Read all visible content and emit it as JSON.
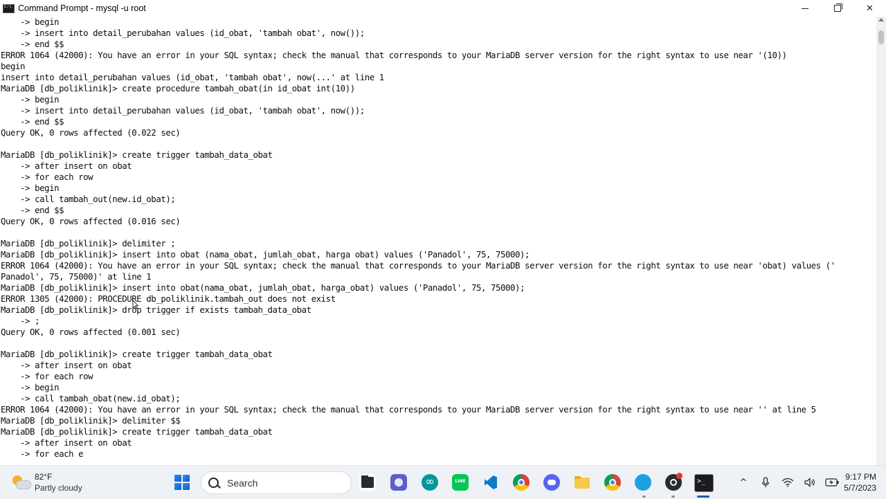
{
  "window": {
    "title": "Command Prompt - mysql  -u root",
    "minimize_icon": "minimize-icon",
    "maximize_icon": "restore-icon",
    "close_glyph": "✕"
  },
  "console_lines": [
    "    -> begin",
    "    -> insert into detail_perubahan values (id_obat, 'tambah obat', now());",
    "    -> end $$",
    "ERROR 1064 (42000): You have an error in your SQL syntax; check the manual that corresponds to your MariaDB server version for the right syntax to use near '(10))",
    "begin",
    "insert into detail_perubahan values (id_obat, 'tambah obat', now(...' at line 1",
    "MariaDB [db_poliklinik]> create procedure tambah_obat(in id_obat int(10))",
    "    -> begin",
    "    -> insert into detail_perubahan values (id_obat, 'tambah obat', now());",
    "    -> end $$",
    "Query OK, 0 rows affected (0.022 sec)",
    "",
    "MariaDB [db_poliklinik]> create trigger tambah_data_obat",
    "    -> after insert on obat",
    "    -> for each row",
    "    -> begin",
    "    -> call tambah_out(new.id_obat);",
    "    -> end $$",
    "Query OK, 0 rows affected (0.016 sec)",
    "",
    "MariaDB [db_poliklinik]> delimiter ;",
    "MariaDB [db_poliklinik]> insert into obat (nama_obat, jumlah_obat, harga obat) values ('Panadol', 75, 75000);",
    "ERROR 1064 (42000): You have an error in your SQL syntax; check the manual that corresponds to your MariaDB server version for the right syntax to use near 'obat) values ('",
    "Panadol', 75, 75000)' at line 1",
    "MariaDB [db_poliklinik]> insert into obat(nama_obat, jumlah_obat, harga_obat) values ('Panadol', 75, 75000);",
    "ERROR 1305 (42000): PROCEDURE db_poliklinik.tambah_out does not exist",
    "MariaDB [db_poliklinik]> drop trigger if exists tambah_data_obat",
    "    -> ;",
    "Query OK, 0 rows affected (0.001 sec)",
    "",
    "MariaDB [db_poliklinik]> create trigger tambah_data_obat",
    "    -> after insert on obat",
    "    -> for each row",
    "    -> begin",
    "    -> call tambah_obat(new.id_obat);",
    "ERROR 1064 (42000): You have an error in your SQL syntax; check the manual that corresponds to your MariaDB server version for the right syntax to use near '' at line 5",
    "MariaDB [db_poliklinik]> delimiter $$",
    "MariaDB [db_poliklinik]> create trigger tambah_data_obat",
    "    -> after insert on obat",
    "    -> for each e"
  ],
  "taskbar": {
    "weather": {
      "temp": "82°F",
      "desc": "Partly cloudy"
    },
    "search_label": "Search",
    "apps": [
      "file-explorer-icon",
      "teams-icon",
      "arduino-icon",
      "line-icon",
      "vscode-icon",
      "chrome-icon",
      "discord-icon",
      "folder-icon",
      "chrome-profile-icon",
      "app-icon",
      "obs-icon",
      "command-prompt-icon"
    ],
    "tray": {
      "chevron": "^",
      "mic": "🎤",
      "wifi": "wifi-icon",
      "volume": "🔊",
      "battery": "battery-icon"
    },
    "clock": {
      "time": "9:17 PM",
      "date": "5/7/2023"
    }
  },
  "colors": {
    "console_bg": "#ffffff",
    "console_text": "#0c0c0c",
    "taskbar_bg": "#eef1f6",
    "accent": "#005fb8"
  }
}
